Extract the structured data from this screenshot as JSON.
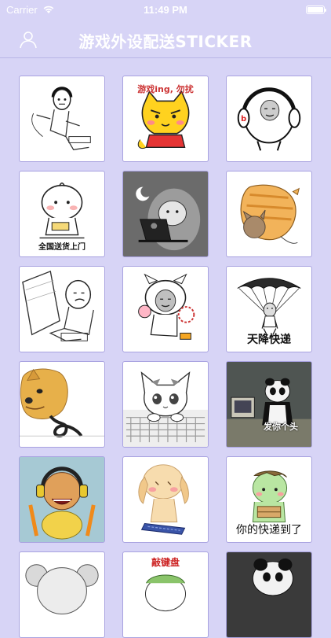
{
  "status": {
    "carrier": "Carrier",
    "time": "11:49 PM"
  },
  "nav": {
    "title": "游戏外设配送STICKER"
  },
  "stickers": [
    {
      "name": "gamer-meme",
      "caption": ""
    },
    {
      "name": "cat-gaming",
      "caption": "游戏ing, 勿扰"
    },
    {
      "name": "headphone-face",
      "caption": ""
    },
    {
      "name": "bun-delivery",
      "caption": "全国送货上门"
    },
    {
      "name": "night-laptop-hamster",
      "caption": ""
    },
    {
      "name": "orange-cat",
      "caption": ""
    },
    {
      "name": "sketch-typing",
      "caption": ""
    },
    {
      "name": "panda-cow",
      "caption": ""
    },
    {
      "name": "parachute",
      "caption": "天降快递"
    },
    {
      "name": "doge-cable",
      "caption": ""
    },
    {
      "name": "chi-cat-keyboard",
      "caption": ""
    },
    {
      "name": "panda-pc",
      "caption": "发你个头"
    },
    {
      "name": "yellow-headset",
      "caption": ""
    },
    {
      "name": "bunny-keyboard",
      "caption": ""
    },
    {
      "name": "green-dino",
      "caption": "你的快递到了"
    },
    {
      "name": "koala-partial",
      "caption": ""
    },
    {
      "name": "keyboard-char",
      "caption": "敲键盘"
    },
    {
      "name": "panda-partial",
      "caption": ""
    }
  ],
  "colors": {
    "background": "#d7d4f6",
    "tile_border": "#a8a2e0",
    "text_light": "#ffffff"
  }
}
